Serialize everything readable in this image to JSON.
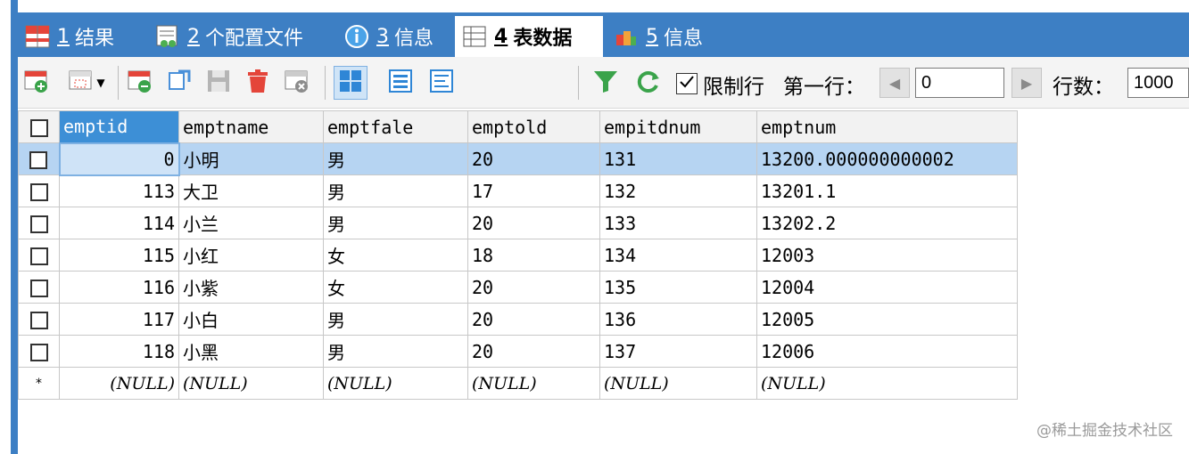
{
  "tabs": [
    {
      "num": "1",
      "label": "结果",
      "icon": "results-grid-icon",
      "active": false
    },
    {
      "num": "2",
      "label": "个配置文件",
      "icon": "profile-icon",
      "active": false
    },
    {
      "num": "3",
      "label": "信息",
      "icon": "info-icon",
      "active": false
    },
    {
      "num": "4",
      "label": "表数据",
      "icon": "table-data-icon",
      "active": true
    },
    {
      "num": "5",
      "label": "信息",
      "icon": "history-info-icon",
      "active": false
    }
  ],
  "toolbar": {
    "limit_rows_label": "限制行",
    "limit_rows_checked": true,
    "first_row_label": "第一行：",
    "first_row_value": "0",
    "row_count_label": "行数：",
    "row_count_value": "1000"
  },
  "table": {
    "columns": [
      "emptid",
      "emptname",
      "emptfale",
      "emptold",
      "empitdnum",
      "emptnum"
    ],
    "rows": [
      [
        "0",
        "小明",
        "男",
        "20",
        "131",
        "13200.000000000002"
      ],
      [
        "113",
        "大卫",
        "男",
        "17",
        "132",
        "13201.1"
      ],
      [
        "114",
        "小兰",
        "男",
        "20",
        "133",
        "13202.2"
      ],
      [
        "115",
        "小红",
        "女",
        "18",
        "134",
        "12003"
      ],
      [
        "116",
        "小紫",
        "女",
        "20",
        "135",
        "12004"
      ],
      [
        "117",
        "小白",
        "男",
        "20",
        "136",
        "12005"
      ],
      [
        "118",
        "小黑",
        "男",
        "20",
        "137",
        "12006"
      ]
    ],
    "new_row_marker": "*",
    "null_text": "(NULL)"
  },
  "watermark": "@稀土掘金技术社区",
  "colors": {
    "tab_bar": "#3d7fc4",
    "selected_row": "#b6d4f2",
    "selected_header": "#3d8fd6"
  }
}
